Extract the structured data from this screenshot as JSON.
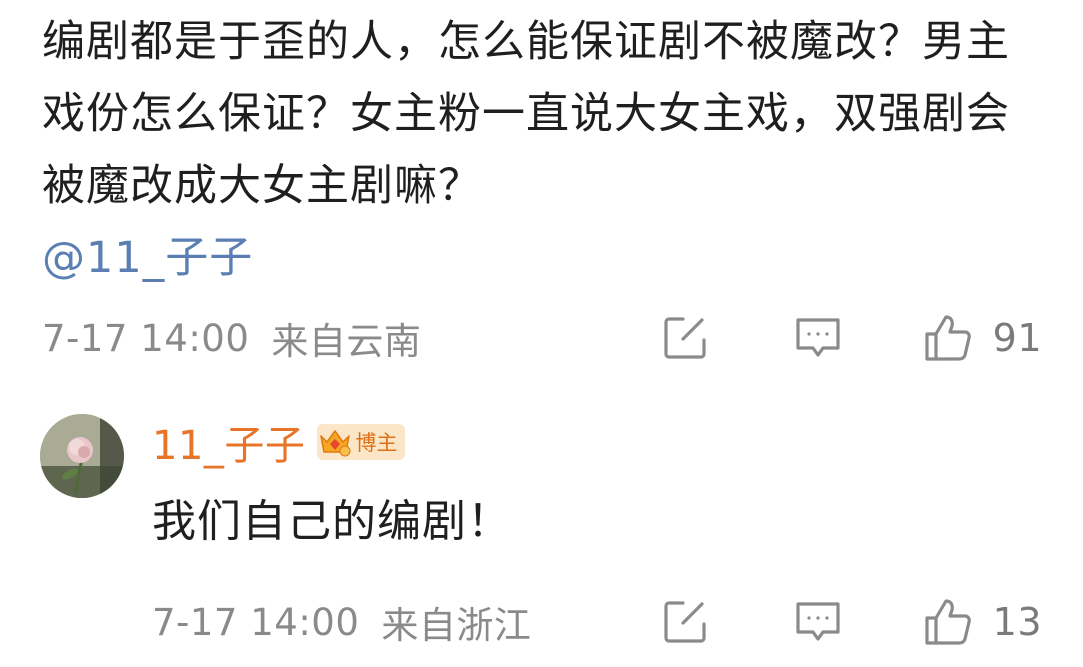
{
  "main_comment": {
    "text": "编剧都是于歪的人，怎么能保证剧不被魔改？男主戏份怎么保证？女主粉一直说大女主戏，双强剧会被魔改成大女主剧嘛？",
    "mention": "@11_子子",
    "time": "7-17 14:00",
    "location": "来自云南",
    "like_count": "91"
  },
  "reply": {
    "username": "11_子子",
    "badge_label": "博主",
    "text": "我们自己的编剧！",
    "time": "7-17 14:00",
    "location": "来自浙江",
    "like_count": "13"
  },
  "icons": {
    "share": "share-icon",
    "comment": "comment-icon",
    "like": "like-icon",
    "badge": "crown-badge-icon"
  },
  "colors": {
    "mention": "#5b7fb3",
    "username": "#e8742a",
    "meta": "#8a8a8a",
    "badge_bg": "#fbe7c8"
  }
}
